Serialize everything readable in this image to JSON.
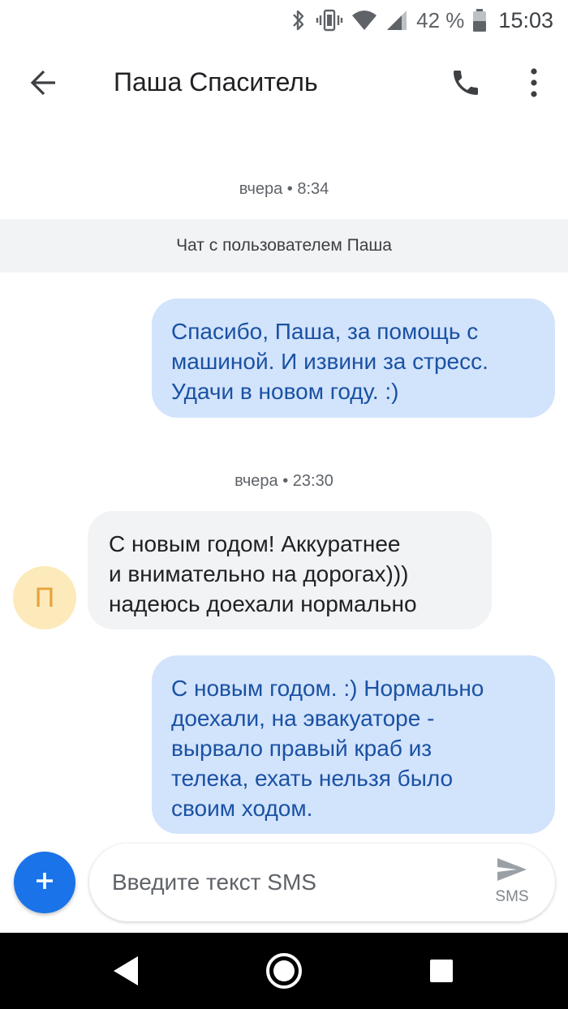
{
  "status_bar": {
    "battery_percent": "42 %",
    "time": "15:03",
    "icons": [
      "bluetooth-icon",
      "vibrate-icon",
      "wifi-icon",
      "signal-icon",
      "battery-icon"
    ]
  },
  "app_bar": {
    "title": "Паша Спаситель",
    "icons": [
      "back-arrow-icon",
      "phone-icon",
      "more-vert-icon"
    ]
  },
  "messages": {
    "ts1": "вчера • 8:34",
    "banner": "Чат с пользователем Паша",
    "msg1": {
      "direction": "outgoing",
      "lines": [
        "Спасибо, Паша, за помощь с",
        "машиной. И извини за стресс.",
        "Удачи в новом году. :)"
      ]
    },
    "ts2": "вчера • 23:30",
    "msg2": {
      "direction": "incoming",
      "avatar_letter": "П",
      "lines": [
        "С новым годом! Аккуратнее",
        "и внимательно на дорогах)))",
        "надеюсь доехали нормально"
      ]
    },
    "msg3": {
      "direction": "outgoing",
      "lines": [
        "С новым годом. :) Нормально",
        "доехали, на эвакуаторе -",
        "вырвало правый краб из",
        "телека, ехать нельзя было",
        "своим ходом."
      ]
    }
  },
  "composer": {
    "placeholder": "Введите текст SMS",
    "send_label": "SMS",
    "icons": [
      "add-icon",
      "send-icon"
    ]
  },
  "nav_bar": {
    "icons": [
      "nav-back-icon",
      "nav-home-icon",
      "nav-recents-icon"
    ]
  },
  "colors": {
    "outgoing_bubble": "#d2e3fc",
    "outgoing_text": "#1a52a3",
    "incoming_bubble": "#f1f3f4",
    "avatar_bg": "#fdeaba",
    "avatar_text": "#e8a23a",
    "fab": "#1a73e8"
  }
}
